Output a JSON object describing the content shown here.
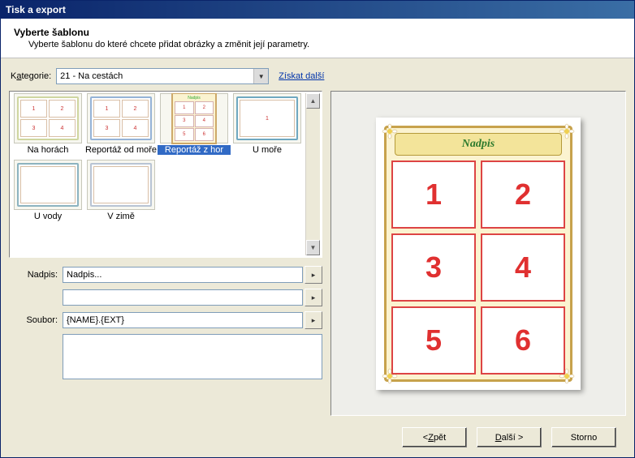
{
  "title": "Tisk a export",
  "header": {
    "title": "Vyberte šablonu",
    "sub": "Vyberte šablonu do které chcete přidat obrázky a změnit její parametry."
  },
  "category": {
    "label_pre": "K",
    "label_u": "a",
    "label_post": "tegorie:",
    "value": "21 - Na cestách",
    "more_link": "Získat další"
  },
  "templates": [
    {
      "label": "Na horách",
      "style": "mountains",
      "selected": false
    },
    {
      "label": "Reportáž od moře",
      "style": "sea2x2",
      "selected": false
    },
    {
      "label": "Reportáž z hor",
      "style": "portrait6",
      "selected": true
    },
    {
      "label": "U moře",
      "style": "sea",
      "selected": false
    },
    {
      "label": "U vody",
      "style": "water",
      "selected": false
    },
    {
      "label": "V zimě",
      "style": "winter",
      "selected": false
    }
  ],
  "form": {
    "nadpis_label": "Nadpis:",
    "nadpis_value": "Nadpis...",
    "soubor_label": "Soubor:",
    "soubor_value": "{NAME}.{EXT}"
  },
  "preview": {
    "banner": "Nadpis",
    "cells": [
      "1",
      "2",
      "3",
      "4",
      "5",
      "6"
    ]
  },
  "buttons": {
    "back_pre": "< ",
    "back_u": "Z",
    "back_post": "pět",
    "next_pre": "",
    "next_u": "D",
    "next_post": "alší >",
    "cancel": "Storno"
  }
}
